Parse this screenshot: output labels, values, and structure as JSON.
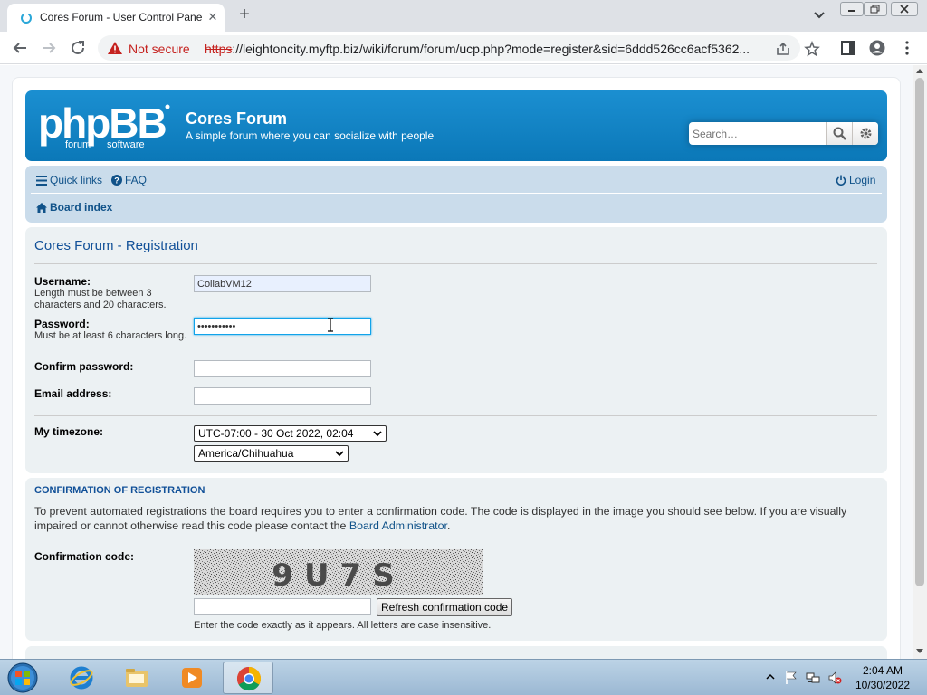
{
  "browser": {
    "tab_title": "Cores Forum - User Control Panel",
    "tab_close_glyph": "✕",
    "new_tab_glyph": "+",
    "not_secure_label": "Not secure",
    "url_scheme": "https",
    "url_rest": "://leightoncity.myftp.biz/wiki/forum/forum/ucp.php?mode=register&sid=6ddd526cc6acf5362..."
  },
  "header": {
    "site_title": "Cores Forum",
    "site_description": "A simple forum where you can socialize with people",
    "search_placeholder": "Search…"
  },
  "navbar": {
    "quick_links": "Quick links",
    "faq": "FAQ",
    "login": "Login",
    "board_index": "Board index"
  },
  "registration": {
    "heading": "Cores Forum - Registration",
    "username_label": "Username:",
    "username_explain": "Length must be between 3 characters and 20 characters.",
    "username_value": "CollabVM12",
    "password_label": "Password:",
    "password_explain": "Must be at least 6 characters long.",
    "password_value": "•••••••••••",
    "confirm_password_label": "Confirm password:",
    "email_label": "Email address:",
    "timezone_label": "My timezone:",
    "timezone_offset": "UTC-07:00 - 30 Oct 2022, 02:04",
    "timezone_zone": "America/Chihuahua"
  },
  "confirmation": {
    "heading": "CONFIRMATION OF REGISTRATION",
    "text_before_link": "To prevent automated registrations the board requires you to enter a confirmation code. The code is displayed in the image you should see below. If you are visually impaired or cannot otherwise read this code please contact the ",
    "link_text": "Board Administrator",
    "text_after_link": ".",
    "code_label": "Confirmation code:",
    "captcha_text": "9U7S",
    "refresh_button": "Refresh confirmation code",
    "note": "Enter the code exactly as it appears. All letters are case insensitive."
  },
  "taskbar": {
    "time": "2:04 AM",
    "date": "10/30/2022"
  },
  "colors": {
    "header_blue": "#0b78b8",
    "link_blue": "#105289",
    "not_secure_red": "#c5221f"
  }
}
